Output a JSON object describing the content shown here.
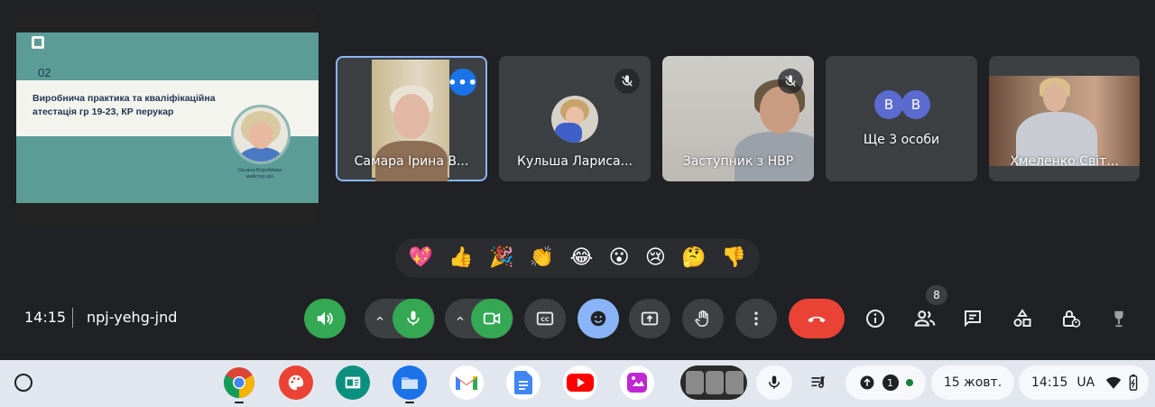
{
  "presentation": {
    "slide_number": "02",
    "slide_title": "Виробнича практика та кваліфікаційна атестація гр 19-23, КР перукар",
    "presenter_name": "Оксана Воробйова",
    "presenter_role": "майстер д/н"
  },
  "participants": [
    {
      "name": "Самара Ірина В...",
      "state": "active-speaker"
    },
    {
      "name": "Кульша Лариса...",
      "state": "muted"
    },
    {
      "name": "Заступник з НВР",
      "state": "muted"
    },
    {
      "name": "Ще 3 особи",
      "initials": [
        "В",
        "В"
      ]
    },
    {
      "name": "Хмеленко Світ..."
    }
  ],
  "reactions": [
    "💖",
    "👍",
    "🎉",
    "👏",
    "😂",
    "😮",
    "😢",
    "🤔",
    "👎"
  ],
  "meeting": {
    "time": "14:15",
    "code": "npj-yehg-jnd",
    "people_count": "8"
  },
  "controls": {
    "audio_output": "speaker-icon",
    "mic": "mic-icon",
    "camera": "camera-icon",
    "captions": "cc-icon",
    "reactions": "emoji-icon",
    "present": "present-icon",
    "raise_hand": "hand-icon",
    "more": "more-vert-icon",
    "leave": "hangup-icon"
  },
  "colors": {
    "background": "#202124",
    "accent_blue": "#8ab4f8",
    "green": "#34a853",
    "red": "#ea4335"
  },
  "shelf": {
    "date": "15 жовт.",
    "time": "14:15",
    "lang": "UA",
    "notification_count": "1"
  }
}
